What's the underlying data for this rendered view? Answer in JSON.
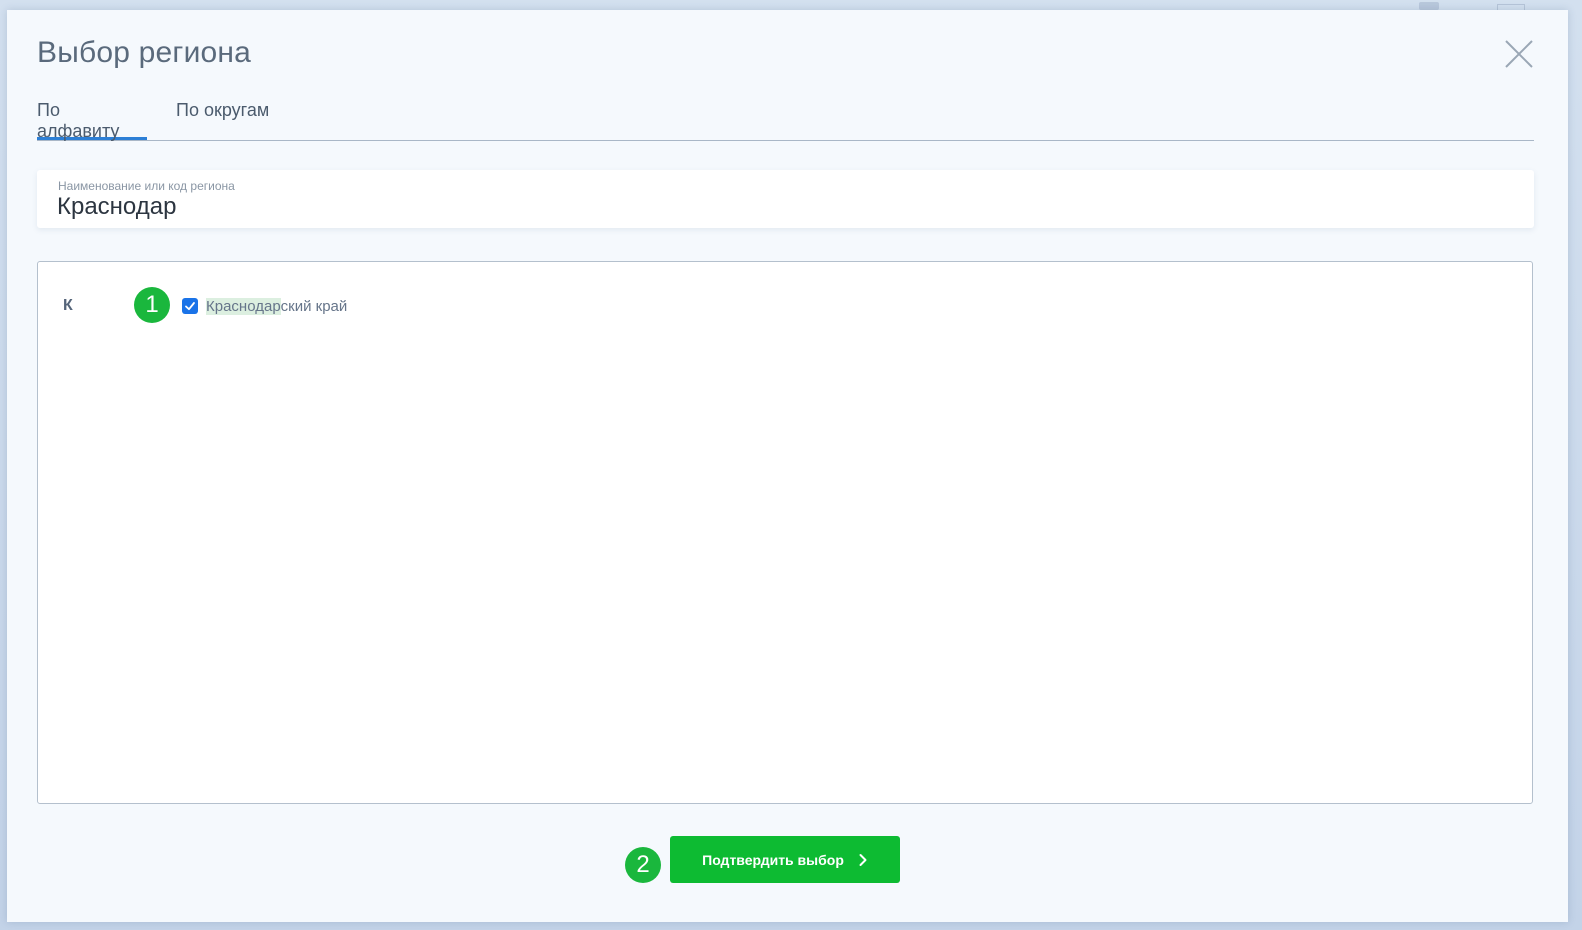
{
  "modal": {
    "title": "Выбор региона"
  },
  "tabs": [
    {
      "label": "По алфавиту",
      "active": true
    },
    {
      "label": "По округам",
      "active": false
    }
  ],
  "search": {
    "label": "Наименование или код региона",
    "value": "Краснодар"
  },
  "list": {
    "groups": [
      {
        "letter": "К",
        "items": [
          {
            "label_match": "Краснодар",
            "label_rest": "ский край",
            "checked": true
          }
        ]
      }
    ]
  },
  "annotations": {
    "step_1": "1",
    "step_2": "2"
  },
  "confirm_button": {
    "label": "Подтвердить выбор"
  },
  "colors": {
    "accent": "#2c7fd6",
    "confirm": "#0dbb32",
    "badge": "#1ab73d",
    "checkbox": "#1a73e8",
    "highlight": "#dcefe0"
  },
  "icons": {
    "close": "close-icon",
    "check": "check-icon",
    "chevron": "chevron-right-icon"
  }
}
